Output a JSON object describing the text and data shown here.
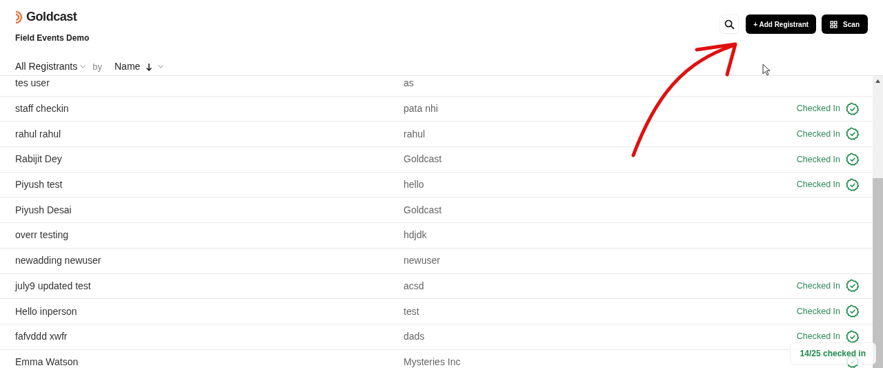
{
  "brand": {
    "name": "Goldcast",
    "event": "Field Events Demo"
  },
  "header_buttons": [
    {
      "kind": "search"
    },
    {
      "kind": "add",
      "label": "+ Add Registrant"
    },
    {
      "kind": "scan",
      "label": "Scan"
    }
  ],
  "filter": {
    "group": "All Registrants",
    "by": "by",
    "sort": "Name"
  },
  "rows": [
    {
      "name": "tes user",
      "company": "as",
      "checked_in": false
    },
    {
      "name": "staff checkin",
      "company": "pata nhi",
      "checked_in": true,
      "status": "Checked In"
    },
    {
      "name": "rahul rahul",
      "company": "rahul",
      "checked_in": true,
      "status": "Checked In"
    },
    {
      "name": "Rabijit Dey",
      "company": "Goldcast",
      "checked_in": true,
      "status": "Checked In"
    },
    {
      "name": "Piyush test",
      "company": "hello",
      "checked_in": true,
      "status": "Checked In"
    },
    {
      "name": "Piyush Desai",
      "company": "Goldcast",
      "checked_in": false
    },
    {
      "name": "overr testing",
      "company": "hdjdk",
      "checked_in": false
    },
    {
      "name": "newadding newuser",
      "company": "newuser",
      "checked_in": false
    },
    {
      "name": "july9 updated test",
      "company": "acsd",
      "checked_in": true,
      "status": "Checked In"
    },
    {
      "name": "Hello inperson",
      "company": "test",
      "checked_in": true,
      "status": "Checked In"
    },
    {
      "name": "fafvddd xwfr",
      "company": "dads",
      "checked_in": true,
      "status": "Checked In"
    },
    {
      "name": "Emma Watson",
      "company": "Mysteries Inc",
      "checked_in": true
    }
  ],
  "summary": "14/25 checked in"
}
